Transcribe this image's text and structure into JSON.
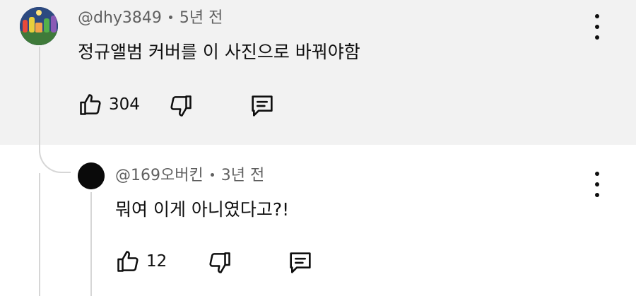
{
  "parent_comment": {
    "author": "@dhy3849",
    "time": "5년 전",
    "text": "정규앨범 커버를 이 사진으로 바꿔야함",
    "likes": "304",
    "avatar_icon": "teletubbies-avatar-icon"
  },
  "reply_comment": {
    "author": "@169오버킨",
    "time": "3년 전",
    "text": "뭐여 이게  아니였다고?!",
    "likes": "12",
    "avatar_icon": "black-circle-avatar"
  },
  "icons": {
    "like": "thumbs-up-icon",
    "dislike": "thumbs-down-icon",
    "reply": "reply-comment-icon",
    "menu": "more-vertical-icon"
  },
  "colors": {
    "parent_bg": "#f2f2f2",
    "meta_text": "#606060",
    "thread_line": "#d6d6d6"
  }
}
